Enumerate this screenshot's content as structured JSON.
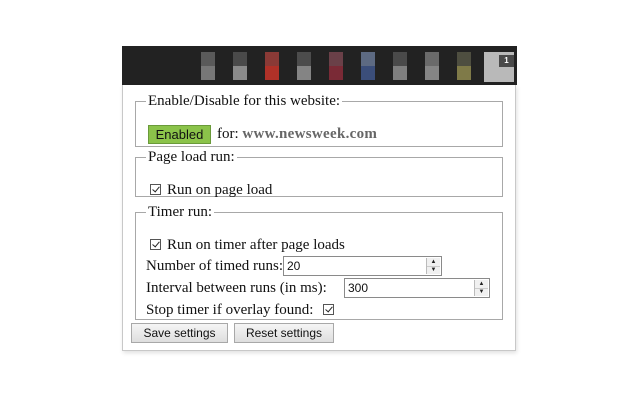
{
  "toolbar": {
    "extension_icons": [
      {
        "name": "ext-icon-1",
        "hi": "#5a5a5a",
        "lo": "#777777"
      },
      {
        "name": "ext-icon-2",
        "hi": "#4a4a4a",
        "lo": "#8a8a8a"
      },
      {
        "name": "ext-icon-3",
        "hi": "#8a3a36",
        "lo": "#b03128"
      },
      {
        "name": "ext-icon-4",
        "hi": "#4c4c4c",
        "lo": "#848484"
      },
      {
        "name": "ext-icon-5",
        "hi": "#6a4048",
        "lo": "#7a2a36"
      },
      {
        "name": "ext-icon-6",
        "hi": "#5d6a82",
        "lo": "#3b4e7a"
      },
      {
        "name": "ext-icon-7",
        "hi": "#4a4a4a",
        "lo": "#7f7f7f"
      },
      {
        "name": "ext-icon-8",
        "hi": "#6a6a6a",
        "lo": "#858585"
      },
      {
        "name": "ext-icon-9",
        "hi": "#4e4e40",
        "lo": "#7f7a48"
      }
    ],
    "badge_count": "1"
  },
  "site_section": {
    "legend": "Enable/Disable for this website:",
    "toggle_label": "Enabled",
    "toggle_color": "#8bc34a",
    "for_label": "for:",
    "site": "www.newsweek.com"
  },
  "page_load_section": {
    "legend": "Page load run:",
    "run_on_load_label": "Run on page load",
    "run_on_load_checked": true
  },
  "timer_section": {
    "legend": "Timer run:",
    "run_on_timer_label": "Run on timer after page loads",
    "run_on_timer_checked": true,
    "num_runs_label": "Number of timed runs:",
    "num_runs_value": "20",
    "interval_label": "Interval between runs (in ms):",
    "interval_value": "300",
    "stop_label": "Stop timer if overlay found:",
    "stop_checked": true
  },
  "actions": {
    "save_label": "Save settings",
    "reset_label": "Reset settings"
  }
}
